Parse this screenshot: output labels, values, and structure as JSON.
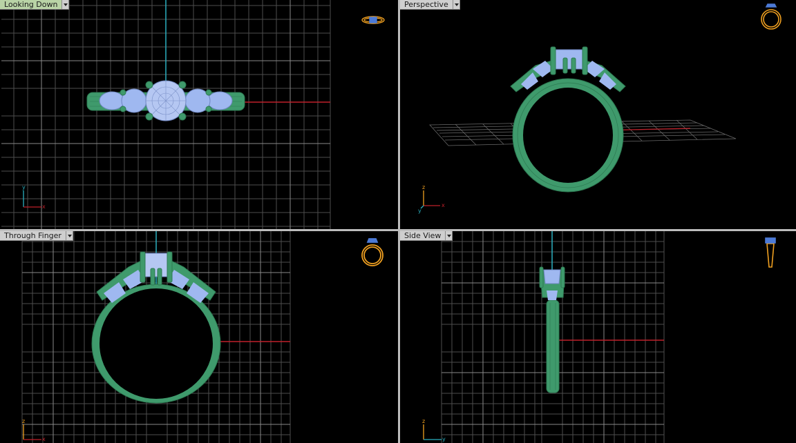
{
  "viewports": [
    {
      "id": "top",
      "label": "Looking Down",
      "active": true,
      "axes": [
        "y",
        "x"
      ]
    },
    {
      "id": "perspective",
      "label": "Perspective",
      "active": false,
      "axes": [
        "z",
        "y",
        "x"
      ]
    },
    {
      "id": "front",
      "label": "Through Finger",
      "active": false,
      "axes": [
        "z",
        "x"
      ]
    },
    {
      "id": "side",
      "label": "Side View",
      "active": false,
      "axes": [
        "z",
        "y"
      ]
    }
  ],
  "colors": {
    "grid": "#5a5a5a",
    "grid_major": "#8a8a8a",
    "ring_metal": "#3f9a6c",
    "gem": "#9fb8f0",
    "axis_x": "#c0202a",
    "axis_y": "#2ab0c0",
    "nav_icon": "#f0a020"
  }
}
